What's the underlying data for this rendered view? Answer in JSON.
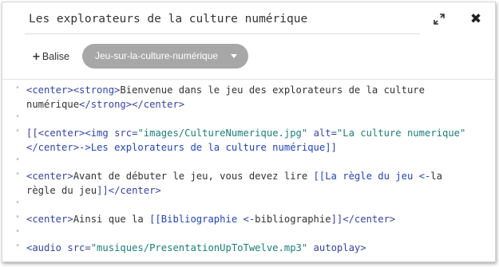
{
  "dialog": {
    "title": "Les explorateurs de la culture numérique",
    "maximize_icon": "expand-arrows-icon",
    "close_icon": "close-x-icon",
    "close_glyph": "✖"
  },
  "toolbar": {
    "balise_plus": "+",
    "balise_label": "Balise",
    "tag_select_value": "Jeu-sur-la-culture-numérique"
  },
  "editor": {
    "line1": {
      "t1": "<center><strong>",
      "t2": "Bienvenue dans le jeu des explorateurs de la culture"
    },
    "line2": {
      "t1": "numérique",
      "t2": "</strong></center>"
    },
    "line4": {
      "t1": "[[",
      "t2": "<center><img src=",
      "t3": "\"images/CultureNumerique.jpg\"",
      "t4": " alt=",
      "t5": "\"La culture numerique\""
    },
    "line5": {
      "t1": "</center>",
      "t2": "->Les explorateurs de la culture numérique]]"
    },
    "line7": {
      "t1": "<center>",
      "t2": "Avant de débuter le jeu, vous devez lire ",
      "t3": "[[La règle du jeu <-",
      "t4": "la"
    },
    "line8": {
      "t1": "règle du jeu",
      "t2": "]]</center>"
    },
    "line10": {
      "t1": "<center>",
      "t2": "Ainsi que la ",
      "t3": "[[Bibliographie <-",
      "t4": "bibliographie",
      "t5": "]]</center>"
    },
    "line12": {
      "t1": "<audio src=",
      "t2": "\"musiques/PresentationUpToTwelve.mp3\"",
      "t3": " autoplay>"
    }
  },
  "colors": {
    "tag": "#3344aa",
    "string": "#1a7f7a",
    "select_bg": "#a7a7a7"
  }
}
